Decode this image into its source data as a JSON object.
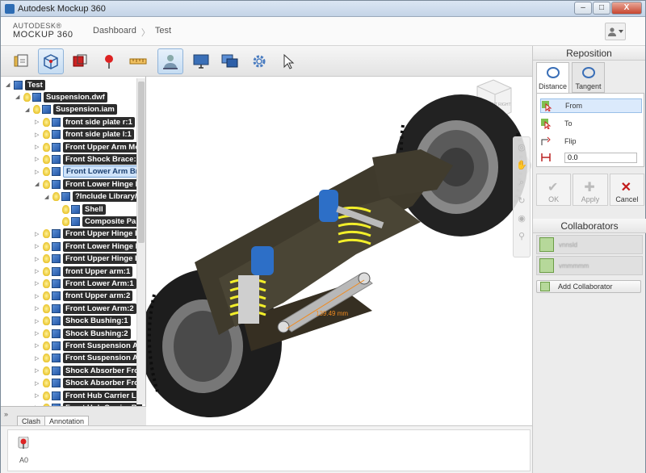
{
  "window": {
    "title": "Autodesk Mockup 360",
    "minimize": "–",
    "maximize": "□",
    "close": "X"
  },
  "header": {
    "logo_line1": "AUTODESK®",
    "logo_line2": "MOCKUP 360",
    "breadcrumb": [
      "Dashboard",
      "Test"
    ],
    "breadcrumb_sep": "〉",
    "user_icon": "user-icon"
  },
  "toolbar": {
    "tools": [
      "open-icon",
      "orbit-cube-icon",
      "section-icon",
      "markup-pin-icon",
      "measure-icon",
      "reposition-person-icon",
      "monitor-icon",
      "multi-window-icon",
      "settings-gear-icon",
      "select-arrow-icon"
    ],
    "active": [
      1,
      5
    ]
  },
  "tree": {
    "items": [
      {
        "label": "Test",
        "level": 0
      },
      {
        "label": "Suspension.dwf",
        "level": 1
      },
      {
        "label": "Suspension.iam",
        "level": 2
      },
      {
        "label": "front side plate r:1",
        "level": 3
      },
      {
        "label": "front side plate l:1",
        "level": 3
      },
      {
        "label": "Front Upper Arm Mo",
        "level": 3
      },
      {
        "label": "Front Shock Brace:1",
        "level": 3
      },
      {
        "label": "Front Lower Arm Bra",
        "level": 3,
        "selected": true
      },
      {
        "label": "Front Lower Hinge P",
        "level": 3
      },
      {
        "label": "?Include Library/",
        "level": 4
      },
      {
        "label": "Shell",
        "level": 5
      },
      {
        "label": "Composite Par",
        "level": 5
      },
      {
        "label": "Front Upper Hinge P",
        "level": 3
      },
      {
        "label": "Front Lower Hinge P",
        "level": 3
      },
      {
        "label": "Front Upper Hinge P",
        "level": 3
      },
      {
        "label": "front Upper arm:1",
        "level": 3
      },
      {
        "label": "Front Lower Arm:1",
        "level": 3
      },
      {
        "label": "front Upper arm:2",
        "level": 3
      },
      {
        "label": "Front Lower Arm:2",
        "level": 3
      },
      {
        "label": "Shock Bushing:1",
        "level": 3
      },
      {
        "label": "Shock Bushing:2",
        "level": 3
      },
      {
        "label": "Front Suspension Ad",
        "level": 3
      },
      {
        "label": "Front Suspension Ad",
        "level": 3
      },
      {
        "label": "Shock Absorber Fror",
        "level": 3
      },
      {
        "label": "Shock Absorber Fror",
        "level": 3
      },
      {
        "label": "Front Hub Carrier L:",
        "level": 3
      },
      {
        "label": "Front Hub Carrier R:",
        "level": 3
      }
    ]
  },
  "bottom_tabs": {
    "collapse": "»",
    "clash": "Clash",
    "annotation": "Annotation"
  },
  "annotation": {
    "pin_label": "A0"
  },
  "viewport": {
    "measure_label": "139.49 mm",
    "viewcube_front": "FRONT",
    "viewcube_right": "RIGHT",
    "viewcube_top": "TOP"
  },
  "reposition": {
    "title": "Reposition",
    "tabs": [
      "Distance",
      "Tangent"
    ],
    "options": [
      "From",
      "To",
      "Flip"
    ],
    "distance_value": "0.0",
    "actions": {
      "ok": "OK",
      "apply": "Apply",
      "cancel": "Cancel"
    }
  },
  "collaborators": {
    "title": "Collaborators",
    "people": [
      "vnnsld",
      "vmmmmm"
    ],
    "add_label": "Add Collaborator"
  }
}
